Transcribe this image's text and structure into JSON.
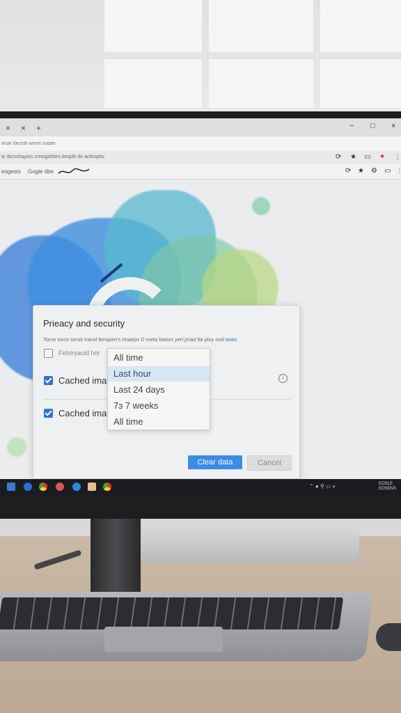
{
  "browser": {
    "tab_close": "×",
    "new_tab": "+",
    "window_controls": [
      "−",
      "□",
      "×"
    ],
    "tab_title": "tesie rlectnh wenrt sotate",
    "address": "ie rbcnshayors cnnogishtes tiespfe de anthoptts",
    "bookmarks": [
      "eogests",
      "Gogle",
      "tibe"
    ]
  },
  "dialog": {
    "title": "Prieacy and security",
    "description": "Torce torce sersk transl bmsperi's Imaeps D meto batsrs yerl jmad lta ploy ood",
    "description_link": "taskt.",
    "rows": [
      {
        "label": "Felstryauld hor",
        "checked": false
      },
      {
        "label": "Cached imag",
        "checked": true
      },
      {
        "label": "Cached imag",
        "checked": true
      }
    ],
    "clear_button": "Clear data",
    "cancel_button": "Cancel"
  },
  "time_range_menu": {
    "options": [
      "All time",
      "Last hour",
      "Last 24 days",
      "7ɜ 7 weeks",
      "All time"
    ],
    "highlighted_index": 1
  },
  "taskbar": {
    "clock_line1": "EOSLE",
    "clock_line2": "EOSENS"
  },
  "colors": {
    "accent": "#3d8be7",
    "checkbox": "#2f76d6",
    "menu_highlight": "#d8e6f5"
  }
}
